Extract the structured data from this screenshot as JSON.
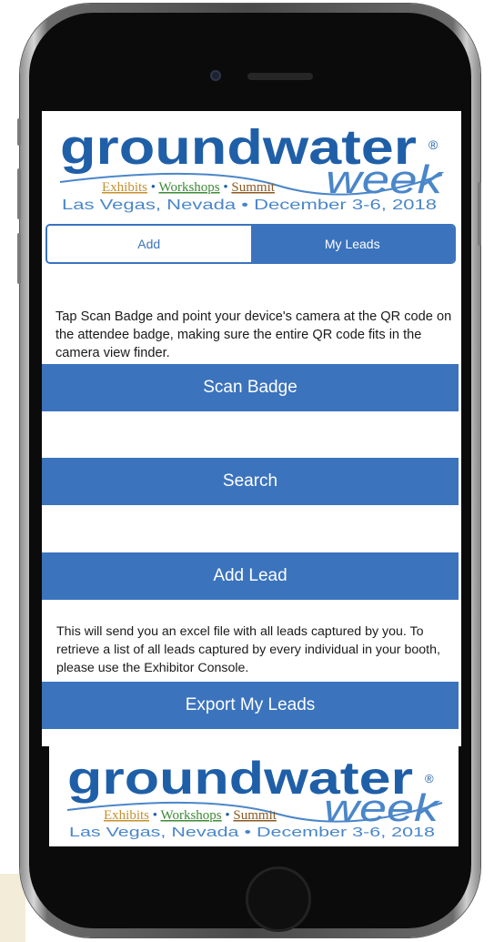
{
  "banner": {
    "title": "groundwater",
    "subtitle": "week",
    "registered": "®",
    "tagline_1": "Exhibits",
    "tagline_sep_1": " • ",
    "tagline_2": "Workshops",
    "tagline_sep_2": " • ",
    "tagline_3": "Summit",
    "location": "Las Vegas, Nevada • December 3-6, 2018"
  },
  "tabs": [
    {
      "label": "Add",
      "active": true
    },
    {
      "label": "My Leads",
      "active": false
    }
  ],
  "instructions": "Tap Scan Badge and point your device's camera at the QR code on the attendee badge, making sure the entire QR code fits in the camera view finder.",
  "buttons": {
    "scan": "Scan Badge",
    "search": "Search",
    "add_lead": "Add Lead",
    "export": "Export My Leads"
  },
  "export_text": "This will send you an excel file with all leads captured by you. To retrieve a list of all leads captured by every individual in your booth, please use the Exhibitor Console.",
  "colors": {
    "primary": "#3b73bd",
    "logo_blue": "#1f5fa8",
    "logo_light": "#4a86c9",
    "exhibits": "#c5902f",
    "workshops": "#3d8a38",
    "summit": "#8a5a22"
  }
}
